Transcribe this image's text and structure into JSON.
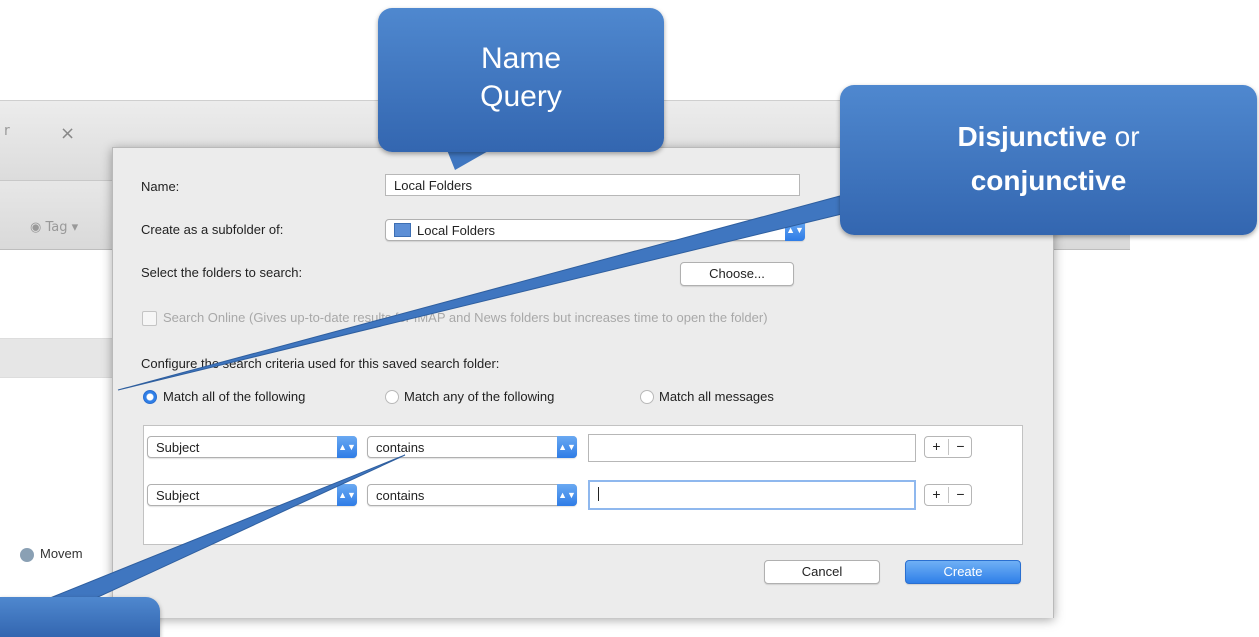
{
  "background": {
    "close_glyph": "×",
    "partial_text": "r",
    "tag_label": "Tag",
    "movement_label": "Movem"
  },
  "dialog": {
    "name_label": "Name:",
    "name_value": "Local Folders",
    "subfolder_label": "Create as a subfolder of:",
    "subfolder_value": "Local Folders",
    "select_folders_label": "Select the folders to search:",
    "choose_button": "Choose...",
    "search_online_label": "Search Online (Gives up-to-date results for IMAP and News folders but increases time to open the folder)",
    "criteria_label": "Configure the search criteria used for this saved search folder:",
    "match_all": "Match all of the following",
    "match_any": "Match any of the following",
    "match_all_messages": "Match all messages",
    "rules": [
      {
        "field": "Subject",
        "operator": "contains",
        "value": ""
      },
      {
        "field": "Subject",
        "operator": "contains",
        "value": ""
      }
    ],
    "plus": "+",
    "minus": "−",
    "cancel_button": "Cancel",
    "create_button": "Create"
  },
  "callouts": {
    "name_query_line1": "Name",
    "name_query_line2": "Query",
    "disjunctive_bold": "Disjunctive",
    "disjunctive_or": " or",
    "conjunctive_bold": "conjunctive"
  },
  "colors": {
    "callout": "#3f76c0",
    "accent": "#2f7fe8"
  }
}
